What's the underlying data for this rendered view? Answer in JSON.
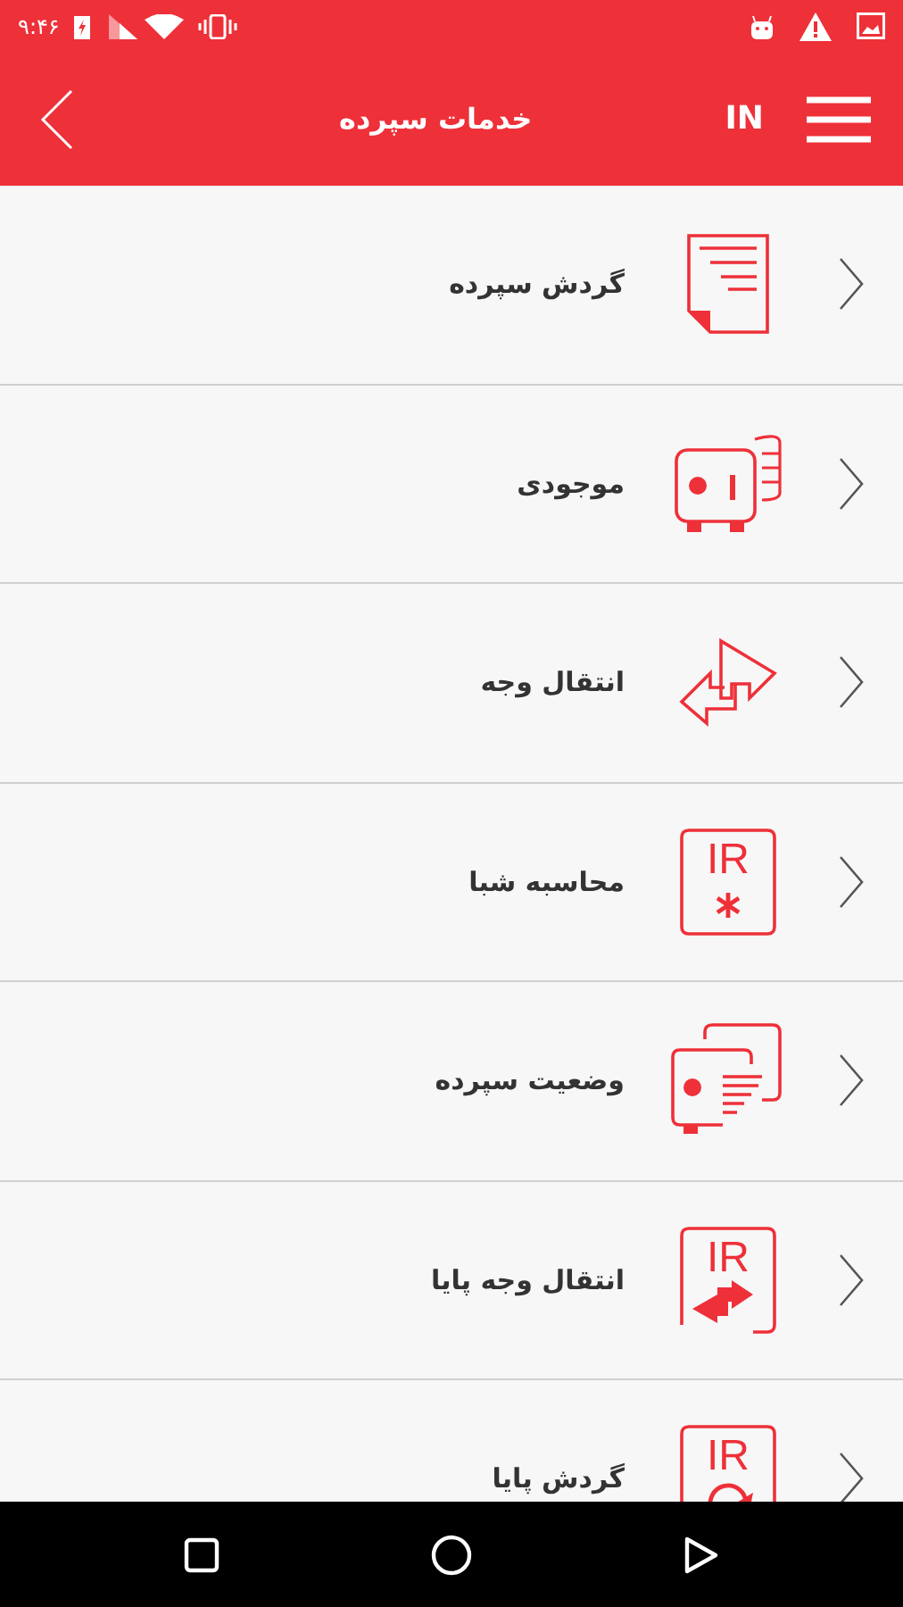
{
  "status_bar": {
    "time": "۹:۴۶"
  },
  "toolbar": {
    "title": "خدمات سپرده",
    "language": "IN"
  },
  "menu_items": [
    {
      "label": "گردش سپرده",
      "kind": "document"
    },
    {
      "label": "موجودی",
      "kind": "safe"
    },
    {
      "label": "انتقال وجه",
      "kind": "exchange"
    },
    {
      "label": "محاسبه شبا",
      "kind": "star",
      "icon_text": "IR"
    },
    {
      "label": "وضعیت سپرده",
      "kind": "status"
    },
    {
      "label": "انتقال وجه پایا",
      "kind": "transfer",
      "icon_text": "IR"
    },
    {
      "label": "گردش پایا",
      "kind": "cycle",
      "icon_text": "IR"
    }
  ]
}
